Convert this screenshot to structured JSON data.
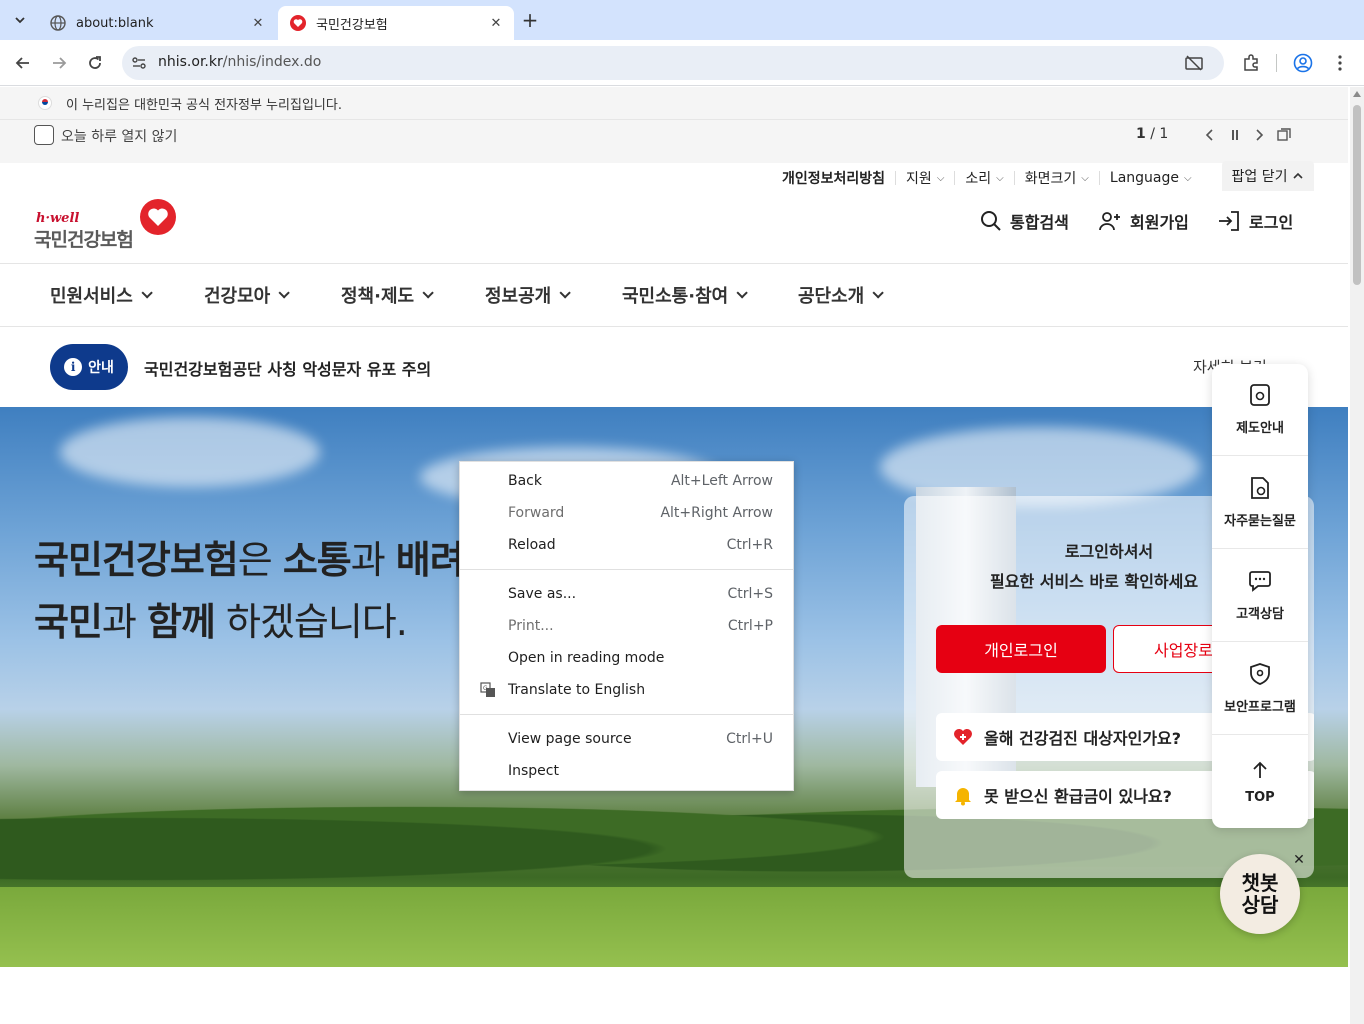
{
  "browser": {
    "tabs": [
      {
        "title": "about:blank",
        "active": false,
        "icon": "globe-icon"
      },
      {
        "title": "국민건강보험",
        "active": true,
        "icon": "nhis-heart-icon"
      }
    ],
    "url": {
      "host": "nhis.or.kr",
      "path": "/nhis/index.do"
    }
  },
  "gov_banner": {
    "text": "이 누리집은 대한민국 공식 전자정부 누리집입니다."
  },
  "popup_bar": {
    "checkbox_label": "오늘 하루 열지 않기",
    "page_current": "1",
    "page_sep": "/",
    "page_total": "1"
  },
  "utility_menu": {
    "privacy": "개인정보처리방침",
    "support": "지원",
    "sound": "소리",
    "screen_size": "화면크기",
    "language": "Language",
    "popup_close": "팝업 닫기"
  },
  "logo": {
    "tagline": "h·well",
    "name": "국민건강보험"
  },
  "header_links": {
    "search": "통합검색",
    "signup": "회원가입",
    "login": "로그인"
  },
  "gnb": [
    "민원서비스",
    "건강모아",
    "정책·제도",
    "정보공개",
    "국민소통·참여",
    "공단소개"
  ],
  "notice": {
    "badge": "안내",
    "text": "국민건강보험공단 사칭 악성문자 유포 주의",
    "more": "자세히 보기"
  },
  "hero": {
    "line1_a": "국민건강보험",
    "line1_b": "은 ",
    "line1_c": "소통",
    "line1_d": "과 ",
    "line1_e": "배려",
    "line2_a": "국민",
    "line2_b": "과 ",
    "line2_c": "함께",
    "line2_d": " 하겠습니다."
  },
  "login_card": {
    "msg1": "로그인하셔서",
    "msg2": "필요한 서비스 바로 확인하세요",
    "personal_login": "개인로그인",
    "business_login": "사업장로그인",
    "quick1": "올해 건강검진 대상자인가요?",
    "quick2": "못 받으신 환급금이 있나요?"
  },
  "side_quick": [
    "제도안내",
    "자주묻는질문",
    "고객상담",
    "보안프로그램",
    "TOP"
  ],
  "chatbot": {
    "line1": "챗봇",
    "line2": "상담"
  },
  "context_menu": [
    {
      "label": "Back",
      "shortcut": "Alt+Left Arrow",
      "enabled": true
    },
    {
      "label": "Forward",
      "shortcut": "Alt+Right Arrow",
      "enabled": false
    },
    {
      "label": "Reload",
      "shortcut": "Ctrl+R",
      "enabled": true
    },
    {
      "label": "Save as...",
      "shortcut": "Ctrl+S",
      "enabled": true
    },
    {
      "label": "Print...",
      "shortcut": "Ctrl+P",
      "enabled": false
    },
    {
      "label": "Open in reading mode",
      "shortcut": "",
      "enabled": true
    },
    {
      "label": "Translate to English",
      "shortcut": "",
      "enabled": true,
      "icon": "translate-icon"
    },
    {
      "label": "View page source",
      "shortcut": "Ctrl+U",
      "enabled": true
    },
    {
      "label": "Inspect",
      "shortcut": "",
      "enabled": true
    }
  ],
  "colors": {
    "nhis_red": "#e60012",
    "notice_navy": "#0e3a8c",
    "chrome_tabbar": "#d3e3fd"
  }
}
